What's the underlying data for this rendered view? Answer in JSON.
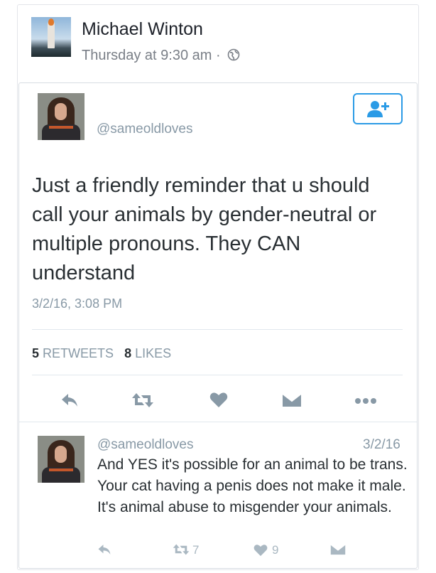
{
  "post": {
    "author": "Michael Winton",
    "timestamp": "Thursday at 9:30 am",
    "separator": "·",
    "privacy_icon": "globe-icon"
  },
  "tweet": {
    "handle": "@sameoldloves",
    "follow_icon": "add-user-icon",
    "text": "Just a friendly reminder that u should call your animals by gender-neutral or multiple pronouns. They CAN understand",
    "date": "3/2/16, 3:08 PM",
    "retweets_count": "5",
    "retweets_label": "RETWEETS",
    "likes_count": "8",
    "likes_label": "LIKES",
    "action_icons": [
      "reply-icon",
      "retweet-icon",
      "like-icon",
      "message-icon",
      "more-icon"
    ]
  },
  "reply": {
    "handle": "@sameoldloves",
    "date": "3/2/16",
    "text": "And YES it's possible for an animal to be trans. Your cat having a penis does not make it male. It's animal abuse to misgender your animals.",
    "retweet_count": "7",
    "like_count": "9"
  },
  "colors": {
    "accent": "#2b9be6",
    "muted": "#8899a6",
    "icon": "#8899a6"
  }
}
